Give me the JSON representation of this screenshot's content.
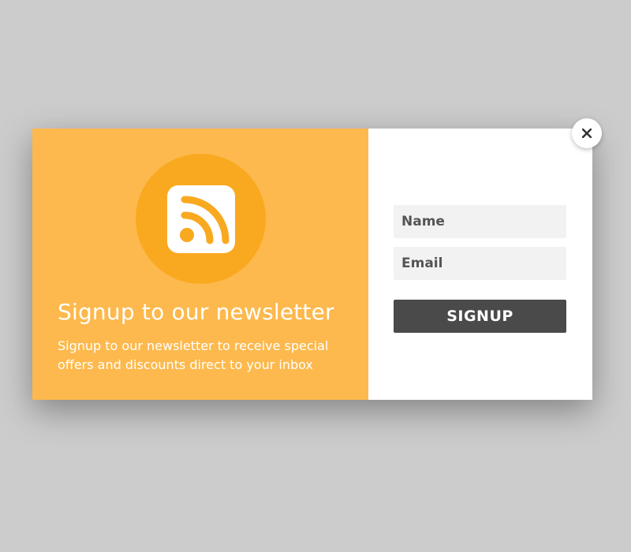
{
  "popup": {
    "heading": "Signup to our newsletter",
    "description": "Signup to our newsletter to receive special offers and discounts direct to your inbox",
    "icon": "rss-feed-icon",
    "close_icon": "close-icon"
  },
  "form": {
    "name_placeholder": "Name",
    "email_placeholder": "Email",
    "submit_label": "SIGNUP"
  },
  "colors": {
    "page_background": "#cccccc",
    "left_panel": "#fdb94d",
    "icon_circle": "#f9a920",
    "button": "#4a4a4a",
    "input_background": "#f2f2f2"
  }
}
